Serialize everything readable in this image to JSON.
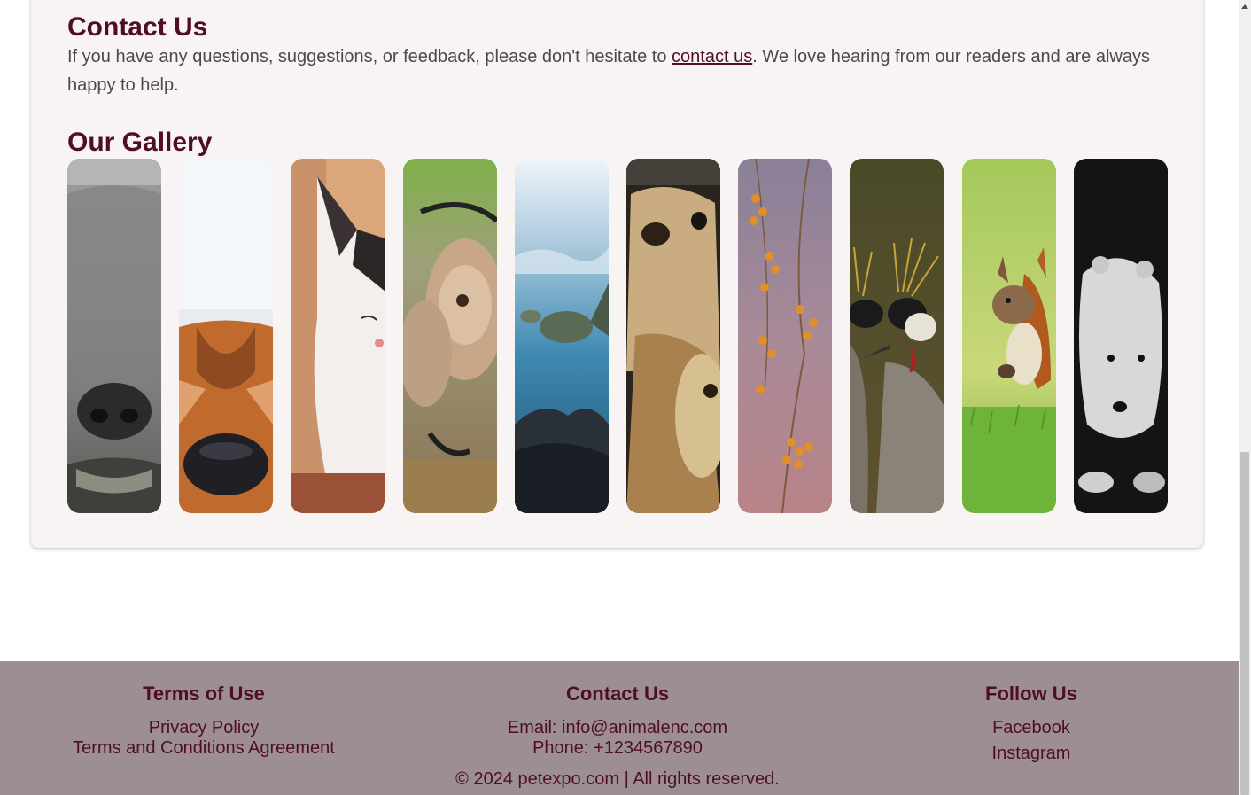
{
  "contact": {
    "title": "Contact Us",
    "text_before": "If you have any questions, suggestions, or feedback, please don't hesitate to ",
    "link_text": "contact us",
    "text_after": ". We love hearing from our readers and are always happy to help."
  },
  "gallery": {
    "title": "Our Gallery",
    "images": [
      {
        "icon": "dog-photo"
      },
      {
        "icon": "fox-photo"
      },
      {
        "icon": "cat-photo"
      },
      {
        "icon": "monkey-photo"
      },
      {
        "icon": "sea-turtle-photo"
      },
      {
        "icon": "meerkat-photo"
      },
      {
        "icon": "berry-branch-photo"
      },
      {
        "icon": "crowned-crane-photo"
      },
      {
        "icon": "squirrel-photo"
      },
      {
        "icon": "polar-bear-cub-photo"
      }
    ]
  },
  "footer": {
    "terms": {
      "title": "Terms of Use",
      "links": [
        "Privacy Policy",
        "Terms and Conditions Agreement"
      ]
    },
    "contact": {
      "title": "Contact Us",
      "email": "Email: info@animalenc.com",
      "phone": "Phone: +1234567890"
    },
    "follow": {
      "title": "Follow Us",
      "links": [
        "Facebook",
        "Instagram"
      ]
    },
    "copyright": "© 2024 petexpo.com | All rights reserved."
  },
  "colors": {
    "heading": "#4f0e22",
    "footer_bg": "#9c8e92",
    "card_bg": "#f8f4f3"
  }
}
